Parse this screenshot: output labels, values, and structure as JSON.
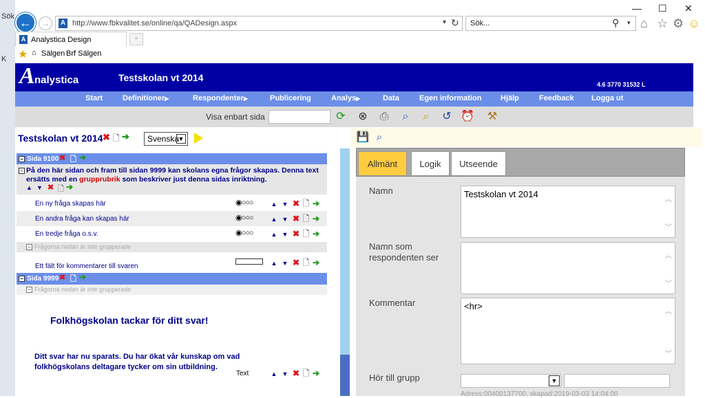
{
  "browser": {
    "url": "http://www.fbkvalitet.se/online/qa/QADesign.aspx",
    "search_placeholder": "Sök...",
    "tab_title": "Analystica Design",
    "fav_links": [
      "Sälgen",
      "Brf Sälgen"
    ],
    "left_strip": [
      "Sök",
      "K"
    ]
  },
  "app": {
    "logo_text": "nalystica",
    "logo_letter": "A",
    "title": "Testskolan vt 2014",
    "version": "4.6 3770 31532 L",
    "menu": [
      {
        "label": "Start",
        "arrow": ""
      },
      {
        "label": "Definitioner",
        "arrow": "▶"
      },
      {
        "label": "Respondenter",
        "arrow": "▶"
      },
      {
        "label": "Publicering",
        "arrow": ""
      },
      {
        "label": "Analys",
        "arrow": "▶"
      },
      {
        "label": "Data",
        "arrow": ""
      },
      {
        "label": "Egen information",
        "arrow": ""
      },
      {
        "label": "Hjälp",
        "arrow": ""
      },
      {
        "label": "Feedback",
        "arrow": ""
      },
      {
        "label": "Logga ut",
        "arrow": ""
      }
    ],
    "toolbar": {
      "label": "Visa enbart sida",
      "input_value": ""
    }
  },
  "left": {
    "title": "Testskolan vt 2014",
    "language": "Svenska",
    "section1": "Sida 9100",
    "group_text_a": "På den här sidan och fram till sidan 9999 kan skolans egna frågor skapas. Denna text ersätts med en ",
    "group_text_red": "grupprubrik",
    "group_text_b": " som beskriver just denna sidas inriktning.",
    "questions": [
      {
        "text": "En ny fråga skapas här",
        "type": "◉○○○"
      },
      {
        "text": "En andra fråga kan skapas här",
        "type": "◉○○○"
      },
      {
        "text": "En tredje fråga o.s.v.",
        "type": "◉○○○"
      }
    ],
    "not_grouped": "Frågorna nedan är inte grupperade",
    "comment_question": "Ett fält för kommentarer till svaren",
    "section2": "Sida 9999",
    "thanks": "Folkhögskolan tackar för ditt svar!",
    "saved": "Ditt svar har nu sparats. Du har ökat vår kunskap om vad folkhögskolans deltagare tycker om sin utbildning.",
    "text_type": "Text"
  },
  "right": {
    "tabs": [
      "Allmänt",
      "Logik",
      "Utseende"
    ],
    "fields": {
      "name_label": "Namn",
      "name_value": "Testskolan vt 2014",
      "resp_label": "Namn som respondenten ser",
      "resp_value": "",
      "comment_label": "Kommentar",
      "comment_value": "<hr>",
      "group_label": "Hör till grupp",
      "address_line": "Adress:00400137700, skapad:2019-03-03 14:04:00"
    }
  },
  "colors": {
    "header_blue": "#0000a4",
    "menu_blue": "#6b8ee8",
    "active_tab": "#ffcc40"
  }
}
